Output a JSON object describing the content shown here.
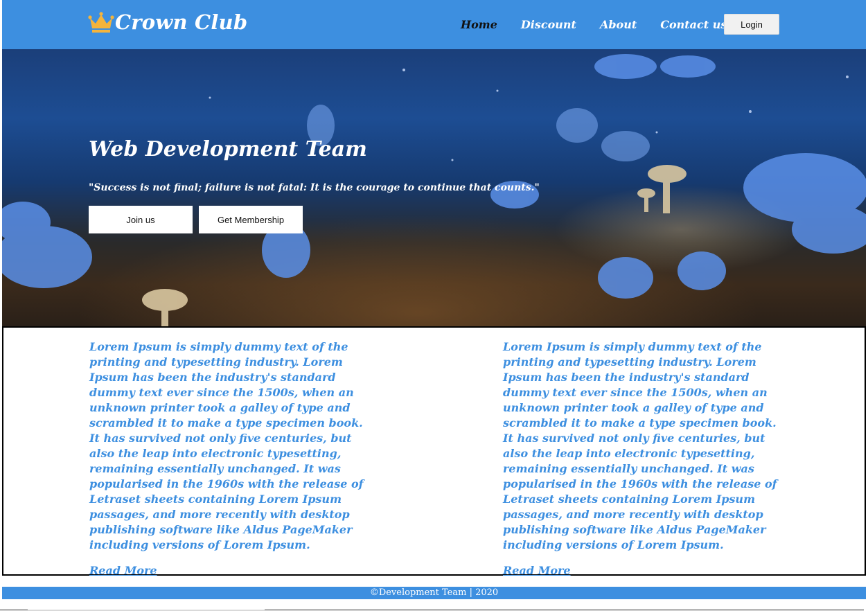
{
  "header": {
    "brand_icon": "crown-icon",
    "brand_name": "Crown Club",
    "nav": [
      "Home",
      "Discount",
      "About",
      "Contact us"
    ],
    "active_nav": "Home",
    "login_label": "Login"
  },
  "hero": {
    "title": "Web Development Team",
    "quote": "\"Success is not final; failure is not fatal: It is the courage to continue that counts.\"",
    "join_label": "Join us",
    "membership_label": "Get Membership"
  },
  "content": {
    "left": {
      "text": "Lorem Ipsum is simply dummy text of the printing and typesetting industry. Lorem Ipsum has been the industry's standard dummy text ever since the 1500s, when an unknown printer took a galley of type and scrambled it to make a type specimen book. It has survived not only five centuries, but also the leap into electronic typesetting, remaining essentially unchanged. It was popularised in the 1960s with the release of Letraset sheets containing Lorem Ipsum passages, and more recently with desktop publishing software like Aldus PageMaker including versions of Lorem Ipsum.",
      "link": "Read More"
    },
    "right": {
      "text": "Lorem Ipsum is simply dummy text of the printing and typesetting industry. Lorem Ipsum has been the industry's standard dummy text ever since the 1500s, when an unknown printer took a galley of type and scrambled it to make a type specimen book. It has survived not only five centuries, but also the leap into electronic typesetting, remaining essentially unchanged. It was popularised in the 1960s with the release of Letraset sheets containing Lorem Ipsum passages, and more recently with desktop publishing software like Aldus PageMaker including versions of Lorem Ipsum.",
      "link": "Read More"
    }
  },
  "footer": {
    "text": "©Development Team | 2020"
  },
  "colors": {
    "primary": "#3d8fe0",
    "crown": "#f4b43c",
    "active_nav": "#111111"
  }
}
